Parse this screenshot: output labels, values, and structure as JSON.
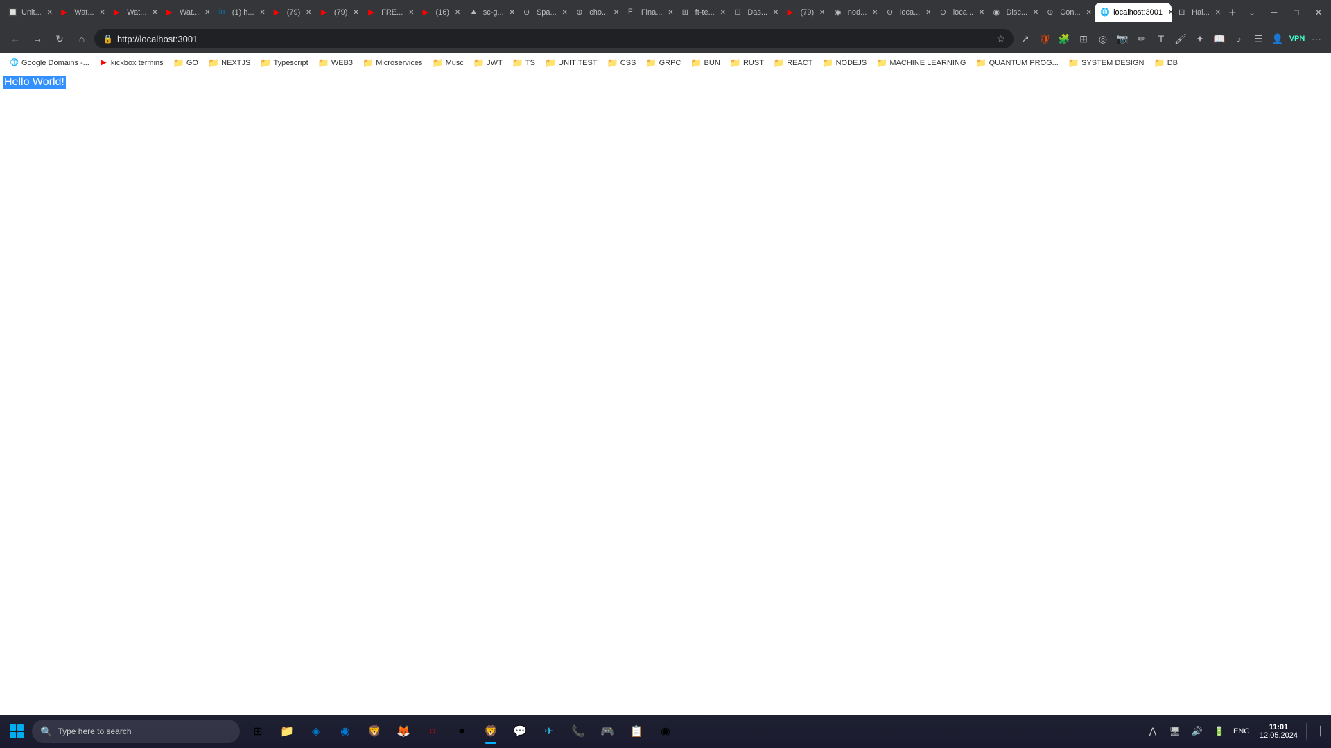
{
  "browser": {
    "tabs": [
      {
        "id": "tab-1",
        "label": "Unit...",
        "favicon": "🔲",
        "active": false
      },
      {
        "id": "tab-2",
        "label": "Wat...",
        "favicon": "▶",
        "active": false,
        "color": "#ff0000"
      },
      {
        "id": "tab-3",
        "label": "Wat...",
        "favicon": "▶",
        "active": false,
        "color": "#ff0000"
      },
      {
        "id": "tab-4",
        "label": "Wat...",
        "favicon": "▶",
        "active": false,
        "color": "#ff0000"
      },
      {
        "id": "tab-5",
        "label": "(1) h...",
        "favicon": "in",
        "active": false,
        "color": "#0077b5"
      },
      {
        "id": "tab-6",
        "label": "(79)",
        "favicon": "▶",
        "active": false,
        "color": "#ff0000",
        "badge": "79"
      },
      {
        "id": "tab-7",
        "label": "(79)",
        "favicon": "▶",
        "active": false,
        "color": "#ff0000"
      },
      {
        "id": "tab-8",
        "label": "FRE...",
        "favicon": "▶",
        "active": false,
        "color": "#ff0000"
      },
      {
        "id": "tab-9",
        "label": "(16)",
        "favicon": "▶",
        "active": false,
        "color": "#ff0000"
      },
      {
        "id": "tab-10",
        "label": "sc-g...",
        "favicon": "▲",
        "active": false
      },
      {
        "id": "tab-11",
        "label": "Spa...",
        "favicon": "⊙",
        "active": false
      },
      {
        "id": "tab-12",
        "label": "cho...",
        "favicon": "⊕",
        "active": false
      },
      {
        "id": "tab-13",
        "label": "Fina...",
        "favicon": "F",
        "active": false
      },
      {
        "id": "tab-14",
        "label": "ft-te...",
        "favicon": "⊞",
        "active": false
      },
      {
        "id": "tab-15",
        "label": "Das...",
        "favicon": "⊡",
        "active": false
      },
      {
        "id": "tab-16",
        "label": "(79)",
        "favicon": "▶",
        "active": false,
        "color": "#ff0000"
      },
      {
        "id": "tab-17",
        "label": "nod...",
        "favicon": "◉",
        "active": false
      },
      {
        "id": "tab-18",
        "label": "loca...",
        "favicon": "⊙",
        "active": false
      },
      {
        "id": "tab-19",
        "label": "loca...",
        "favicon": "⊙",
        "active": false
      },
      {
        "id": "tab-20",
        "label": "Disc...",
        "favicon": "◉",
        "active": false
      },
      {
        "id": "tab-21",
        "label": "Con...",
        "favicon": "⊕",
        "active": false
      },
      {
        "id": "tab-22",
        "label": "loca...",
        "favicon": "⊙",
        "active": true
      },
      {
        "id": "tab-23",
        "label": "Hai...",
        "favicon": "⊡",
        "active": false
      }
    ],
    "address": "http://localhost:3001",
    "page_title": "localhost:3001"
  },
  "bookmarks": [
    {
      "label": "Google Domains -...",
      "type": "folder",
      "icon": "🌐"
    },
    {
      "label": "kickbox termins",
      "type": "item",
      "favicon_color": "#ff0000",
      "favicon": "▶"
    },
    {
      "label": "GO",
      "type": "folder"
    },
    {
      "label": "NEXTJS",
      "type": "folder"
    },
    {
      "label": "Typescript",
      "type": "folder"
    },
    {
      "label": "WEB3",
      "type": "folder"
    },
    {
      "label": "Microservices",
      "type": "folder"
    },
    {
      "label": "Musc",
      "type": "folder"
    },
    {
      "label": "JWT",
      "type": "folder"
    },
    {
      "label": "TS",
      "type": "folder"
    },
    {
      "label": "UNIT TEST",
      "type": "folder"
    },
    {
      "label": "CSS",
      "type": "folder"
    },
    {
      "label": "GRPC",
      "type": "folder"
    },
    {
      "label": "BUN",
      "type": "folder"
    },
    {
      "label": "RUST",
      "type": "folder"
    },
    {
      "label": "REACT",
      "type": "folder"
    },
    {
      "label": "NODEJS",
      "type": "folder"
    },
    {
      "label": "MACHINE LEARNING",
      "type": "folder"
    },
    {
      "label": "QUANTUM PROG...",
      "type": "folder"
    },
    {
      "label": "SYSTEM DESIGN",
      "type": "folder"
    },
    {
      "label": "DB",
      "type": "folder"
    }
  ],
  "page": {
    "content": "Hello World!"
  },
  "taskbar": {
    "search_placeholder": "Type here to search",
    "apps": [
      {
        "name": "task-view",
        "icon": "⊞"
      },
      {
        "name": "file-explorer",
        "icon": "📁"
      },
      {
        "name": "vscode",
        "icon": "◈"
      },
      {
        "name": "edge",
        "icon": "◉"
      },
      {
        "name": "brave",
        "icon": "🦁"
      },
      {
        "name": "firefox",
        "icon": "🦊"
      },
      {
        "name": "opera",
        "icon": "○"
      },
      {
        "name": "chrome",
        "icon": "●"
      },
      {
        "name": "brave2",
        "icon": "🦁"
      },
      {
        "name": "whatsapp",
        "icon": "💬"
      },
      {
        "name": "telegram",
        "icon": "✈"
      },
      {
        "name": "viber",
        "icon": "📞"
      },
      {
        "name": "discord",
        "icon": "🎮"
      },
      {
        "name": "sticky",
        "icon": "📋"
      },
      {
        "name": "unknown",
        "icon": "◉"
      }
    ],
    "time": "11:01",
    "date": "12.05.2024",
    "language": "ENG"
  }
}
